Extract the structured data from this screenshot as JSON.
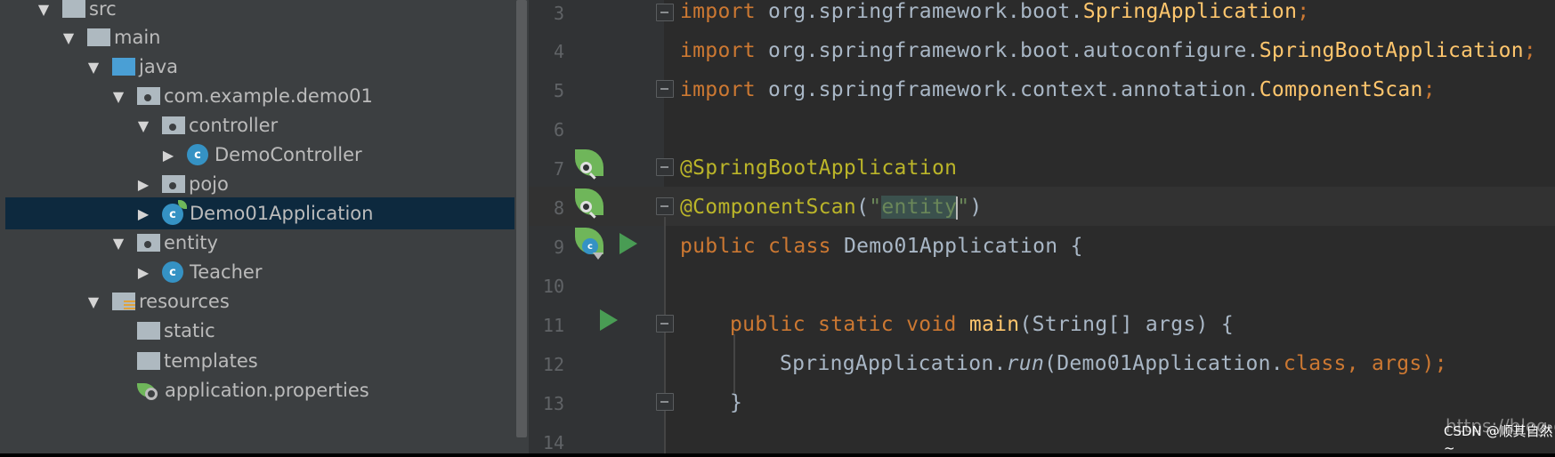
{
  "project_tree": {
    "items": [
      {
        "label": "src",
        "level": 0,
        "expanded": true,
        "icon": "folder-icon"
      },
      {
        "label": "main",
        "level": 1,
        "expanded": true,
        "icon": "folder-icon"
      },
      {
        "label": "java",
        "level": 2,
        "expanded": true,
        "icon": "source-folder-icon"
      },
      {
        "label": "com.example.demo01",
        "level": 3,
        "expanded": true,
        "icon": "package-icon"
      },
      {
        "label": "controller",
        "level": 4,
        "expanded": true,
        "icon": "package-icon"
      },
      {
        "label": "DemoController",
        "level": 5,
        "expanded": false,
        "icon": "class-icon"
      },
      {
        "label": "pojo",
        "level": 4,
        "expanded": false,
        "icon": "package-icon"
      },
      {
        "label": "Demo01Application",
        "level": 4,
        "expanded": false,
        "icon": "spring-boot-class-icon",
        "selected": true
      },
      {
        "label": "entity",
        "level": 3,
        "expanded": true,
        "icon": "package-icon"
      },
      {
        "label": "Teacher",
        "level": 4,
        "expanded": false,
        "icon": "class-icon"
      },
      {
        "label": "resources",
        "level": 2,
        "expanded": true,
        "icon": "resources-folder-icon"
      },
      {
        "label": "static",
        "level": 3,
        "icon": "folder-icon"
      },
      {
        "label": "templates",
        "level": 3,
        "icon": "folder-icon"
      },
      {
        "label": "application.properties",
        "level": 3,
        "icon": "spring-properties-icon"
      }
    ],
    "class_badge": "c"
  },
  "editor": {
    "line_numbers": [
      "3",
      "4",
      "5",
      "6",
      "7",
      "8",
      "9",
      "10",
      "11",
      "12",
      "13",
      "14"
    ],
    "lines": {
      "l3": {
        "kw": "import",
        "rest": " org.springframework.boot.",
        "cls": "SpringApplication",
        "end": ";"
      },
      "l4": {
        "kw": "import",
        "rest": " org.springframework.boot.autoconfigure.",
        "cls": "SpringBootApplication",
        "end": ";"
      },
      "l5": {
        "kw": "import",
        "rest": " org.springframework.context.annotation.",
        "cls": "ComponentScan",
        "end": ";"
      },
      "l7": {
        "ann": "@SpringBootApplication"
      },
      "l8": {
        "ann": "@ComponentScan",
        "open": "(",
        "str_open": "\"",
        "str_val": "entity",
        "str_close": "\"",
        "close": ")"
      },
      "l9": {
        "kw1": "public",
        "kw2": "class",
        "name": "Demo01Application",
        "brace": "{"
      },
      "l11": {
        "kw1": "public",
        "kw2": "static",
        "kw3": "void",
        "fn": "main",
        "params": "(String[] args)",
        "brace": "{"
      },
      "l12": {
        "obj": "SpringApplication.",
        "fn": "run",
        "args1": "(Demo01Application.",
        "kw": "class",
        "args2": ", args)",
        "end": ";"
      },
      "l13": {
        "brace": "}"
      }
    }
  },
  "watermark": "CSDN @顺其自然~",
  "url_fragment": "https://blog.c",
  "colors": {
    "keyword": "#cc7832",
    "annotation": "#bbb529",
    "string": "#6a8759",
    "function": "#ffc66d",
    "default": "#a9b7c6",
    "selection": "#0d293e"
  }
}
